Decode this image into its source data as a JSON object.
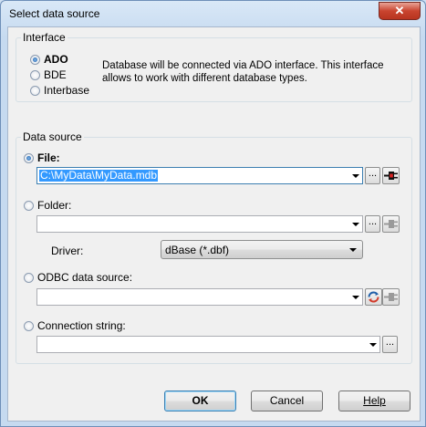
{
  "window": {
    "title": "Select data source",
    "close_glyph": "✕"
  },
  "interface": {
    "legend": "Interface",
    "options": [
      {
        "label": "ADO",
        "selected": true
      },
      {
        "label": "BDE",
        "selected": false
      },
      {
        "label": "Interbase",
        "selected": false
      }
    ],
    "description": "Database will be connected via ADO interface. This interface allows to work with different database types."
  },
  "data_source": {
    "legend": "Data source",
    "file": {
      "label": "File:",
      "selected": true,
      "value": "C:\\MyData\\MyData.mdb",
      "browse": "..."
    },
    "folder": {
      "label": "Folder:",
      "selected": false,
      "value": "",
      "browse": "..."
    },
    "driver": {
      "label": "Driver:",
      "value": "dBase (*.dbf)"
    },
    "odbc": {
      "label": "ODBC data source:",
      "selected": false,
      "value": ""
    },
    "connection_string": {
      "label": "Connection string:",
      "selected": false,
      "value": "",
      "browse": "..."
    }
  },
  "buttons": {
    "ok": "OK",
    "cancel": "Cancel",
    "help": "Help"
  },
  "colors": {
    "accent": "#3399ff",
    "close": "#c9442f"
  }
}
